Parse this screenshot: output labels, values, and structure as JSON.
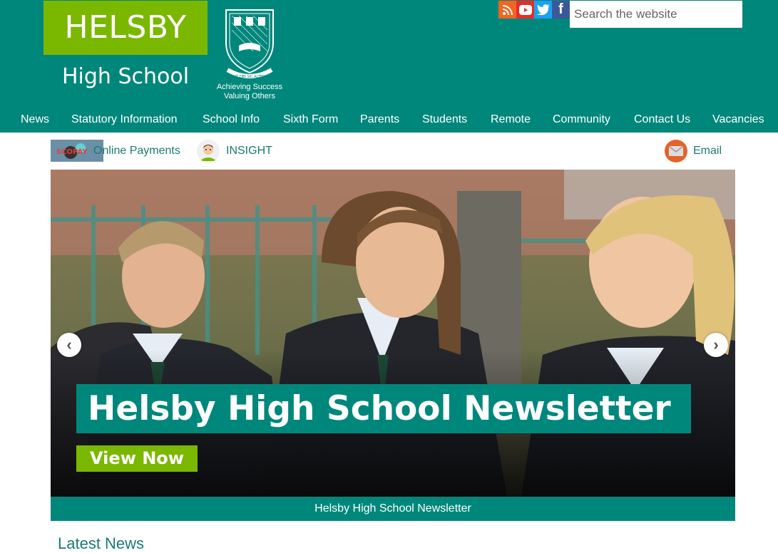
{
  "brand": {
    "logo_text": "HELSBY",
    "subtitle": "High School",
    "motto_line1": "Achieving Success",
    "motto_line2": "Valuing Others",
    "crest_text": "UT TIBI SIC ALTERI",
    "primary_color": "#00877b",
    "accent_color": "#7ab800"
  },
  "social": [
    {
      "name": "rss-icon",
      "glyph": "⦿"
    },
    {
      "name": "youtube-icon",
      "glyph": "▶"
    },
    {
      "name": "twitter-icon",
      "glyph": "t"
    },
    {
      "name": "facebook-icon",
      "glyph": "f"
    }
  ],
  "search": {
    "placeholder": "Search the website"
  },
  "nav": [
    {
      "label": "News",
      "name": "nav-item-news"
    },
    {
      "label": "Statutory Information",
      "name": "nav-item-statutory-information"
    },
    {
      "label": "School Info",
      "name": "nav-item-school-info"
    },
    {
      "label": "Sixth Form",
      "name": "nav-item-sixth-form"
    },
    {
      "label": "Parents",
      "name": "nav-item-parents"
    },
    {
      "label": "Students",
      "name": "nav-item-students"
    },
    {
      "label": "Remote",
      "name": "nav-item-remote"
    },
    {
      "label": "Community",
      "name": "nav-item-community"
    },
    {
      "label": "Contact Us",
      "name": "nav-item-contact-us"
    },
    {
      "label": "Vacancies",
      "name": "nav-item-vacancies"
    }
  ],
  "quick_links": {
    "scopay_logo_text": "SCOPAY",
    "payments": "Online Payments",
    "insight": "INSIGHT",
    "email": "Email"
  },
  "hero": {
    "headline": "Helsby High School Newsletter",
    "cta": "View Now",
    "caption": "Helsby High School Newsletter",
    "prev_glyph": "‹",
    "next_glyph": "›"
  },
  "sections": {
    "latest_news": "Latest News"
  }
}
